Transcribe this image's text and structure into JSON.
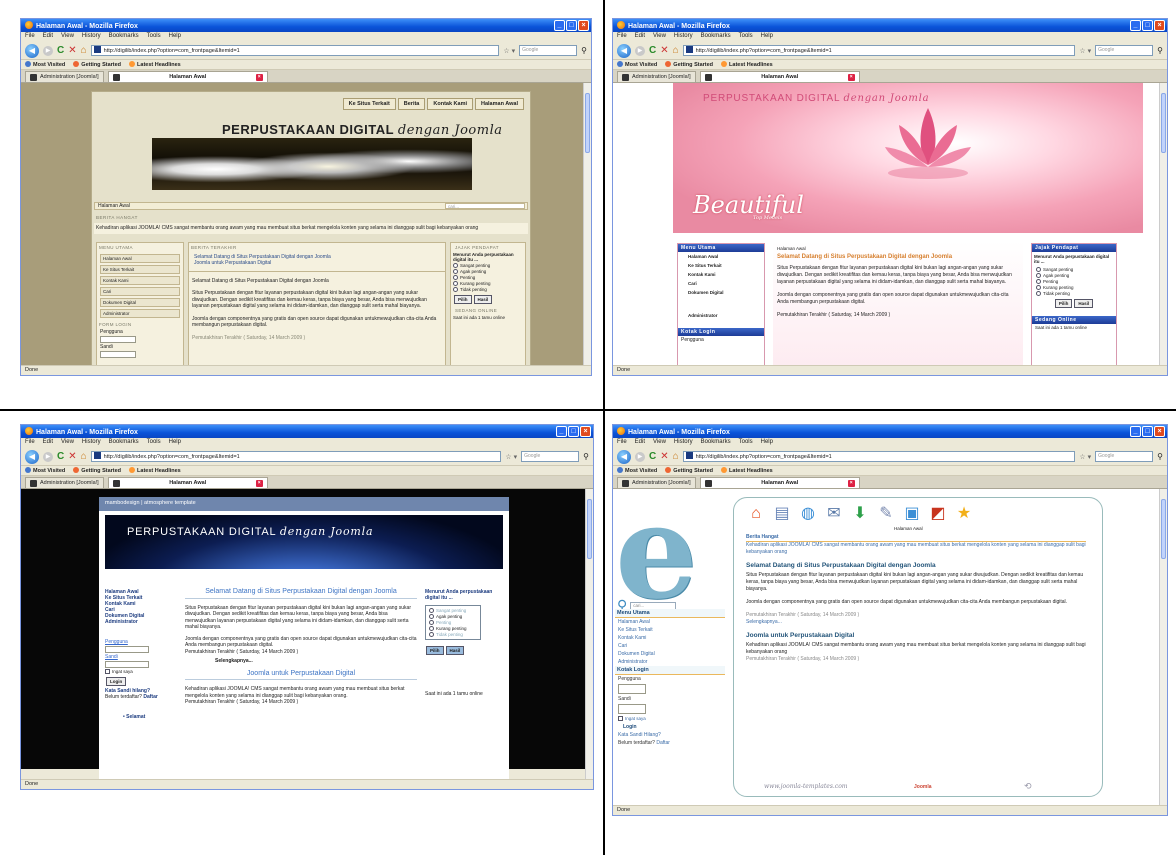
{
  "browser": {
    "window_title": "Halaman Awal - Mozilla Firefox",
    "menu": [
      "File",
      "Edit",
      "View",
      "History",
      "Bookmarks",
      "Tools",
      "Help"
    ],
    "url": "http://digilib/index.php?option=com_frontpage&Itemid=1",
    "search_placeholder": "Google",
    "bookmarks": [
      "Most Visited",
      "Getting Started",
      "Latest Headlines"
    ],
    "tab_inactive": "Administration [Joomla!]",
    "tab_active": "Halaman Awal",
    "status": "Done"
  },
  "site1": {
    "menu": [
      "Ke Situs Terkait",
      "Berita",
      "Kontak Kami",
      "Halaman Awal"
    ],
    "title_main": "PERPUSTAKAAN DIGITAL",
    "title_script": "dengan Joomla",
    "breadcrumb": "Halaman Awal",
    "search": "cari...",
    "heading_berita": "BERITA HANGAT",
    "intro": "Kehadiran aplikasi JOOMLA! CMS sangat membantu orang awam yang mau membuat situs berkat mengelola konten yang selama ini dianggap sulit bagi kebanyakan orang",
    "menu_utama_title": "MENU UTAMA",
    "menu_utama": [
      "Halaman Awal",
      "Ke Situs Terkait",
      "Kontak Kami",
      "Cari",
      "Dokumen Digital",
      "Administrator"
    ],
    "login_title": "FORM LOGIN",
    "login_user": "Pengguna",
    "login_pass": "Sandi",
    "berita_terakhir_title": "BERITA TERAKHIR",
    "berita_terakhir": [
      "Selamat Datang di Situs Perpustakaan Digital dengan Joomla",
      "Joomla untuk Perpustakaan Digital"
    ],
    "article_title": "Selamat Datang di Situs Perpustakaan Digital dengan Joomla",
    "article_body": "Situs Perpustakaan dengan fitur layanan perpustakaan digital kini bukan lagi angan-angan yang sukar diwujudkan. Dengan sedikit kreatifitas dan kemau keras, tanpa biaya yang besar, Anda bisa menwujudkan layanan perpustakaan digital yang selama ini didam-idamkan, dan dianggap sulit serta mahal biayanya.",
    "article_body2": "Joomla dengan componentnya yang gratis dan open source dapat digunakan untukmewujudkan cita-cita Anda membangun perpustakaan digital.",
    "article_updated": "Pemutakhiran Terakhir ( Saturday, 14 March 2009 )",
    "poll_title": "JAJAK PENDAPAT",
    "poll_question": "Menurut Anda perpustakaan digital itu ...",
    "poll_options": [
      "Sangat penting",
      "Agak penting",
      "Penting",
      "Kurang penting",
      "Tidak penting"
    ],
    "poll_vote": "Pilih",
    "poll_result": "Hasil",
    "online_title": "SEDANG ONLINE",
    "online_text": "Saat ini ada 1 tamu online"
  },
  "site2": {
    "title_main": "PERPUSTAKAAN DIGITAL",
    "title_script": "dengan Joomla",
    "beautiful": "Beautiful",
    "beautiful_sub": "Top Models",
    "menu_utama_title": "Menu Utama",
    "menu_utama": [
      "Halaman Awal",
      "Ke Situs Terkait",
      "Kontak Kami",
      "Cari",
      "Dokumen Digital",
      "Administrator"
    ],
    "login_title": "Kotak Login",
    "login_user": "Pengguna",
    "breadcrumb": "Halaman Awal",
    "article_title": "Selamat Datang di Situs Perpustakaan Digital dengan Joomla",
    "article_body": "Situs Perpustakaan dengan fitur layanan perpustakaan digital kini bukan lagi angan-angan yang sukar diwujudkan. Dengan sedikit kreatifitas dan kemau keras, tanpa biaya yang besar, Anda bisa menwujudkan layanan perpustakaan digital yang selama ini didam-idamkan, dan dianggap sulit serta mahal biayanya.",
    "article_body2": "Joomla dengan componentnya yang gratis dan open source dapat digunakan untukmewujudkan cita-cita Anda membangun perpustakaan digital.",
    "article_updated": "Pemutakhiran Terakhir ( Saturday, 14 March 2009 )",
    "poll_title": "Jajak Pendapat",
    "poll_question": "Menurut Anda perpustakaan digital itu ...",
    "poll_options": [
      "Sangat penting",
      "Agak penting",
      "Penting",
      "Kurang penting",
      "Tidak penting"
    ],
    "poll_vote": "Pilih",
    "poll_result": "Hasil",
    "online_title": "Sedang Online",
    "online_text": "Saat ini ada 1 tamu online"
  },
  "site3": {
    "top": "mambodesign | atmosphere template",
    "title_main": "PERPUSTAKAAN DIGITAL",
    "title_script": "dengan Joomla",
    "menu": [
      "Halaman Awal",
      "Ke Situs Terkait",
      "Kontak Kami",
      "Cari",
      "Dokumen Digital",
      "Administrator"
    ],
    "login_user": "Pengguna",
    "login_pass": "Sandi",
    "remember": "Ingat saya",
    "login_btn": "Login",
    "forgot": "Kata Sandi hilang?",
    "register_q": "Belum terdaftar?",
    "register": "Daftar",
    "bullet": "Selamat",
    "article_title": "Selamat Datang di Situs Perpustakaan Digital dengan Joomla",
    "article_body": "Situs Perpustakaan dengan fitur layanan perpustakaan digital kini bukan lagi angan-angan yang sukar diwujudkan. Dengan sedikit kreatifitas dan kemau keras, tanpa biaya yang besar, Anda bisa menwujudkan layanan perpustakaan digital yang selama ini didam-idamkan, dan dianggap sulit serta mahal biayanya.",
    "article_body2": "Joomla dengan componentnya yang gratis dan open source dapat digunakan untukmewujudkan cita-cita Anda membangun perpustakaan digital.",
    "article_updated": "Pemutakhiran Terakhir ( Saturday, 14 March 2009 )",
    "readmore": "Selengkapnya...",
    "article2_title": "Joomla untuk Perpustakaan Digital",
    "article2_body": "Kehadiran aplikasi JOOMLA! CMS sangat membantu orang awam yang mau membuat situs berkat mengelola konten yang selama ini dianggap sulit bagi kebanyakan orang.",
    "article2_updated": "Pemutakhiran Terakhir ( Saturday, 14 March 2009 )",
    "poll_question": "Menurut Anda perpustakaan digital itu ...",
    "poll_options": [
      "Sangat penting",
      "Agak penting",
      "Penting",
      "Kurang penting",
      "Tidak penting"
    ],
    "poll_vote": "Pilih",
    "poll_result": "Hasil",
    "online_text": "Saat ini ada 1 tamu online"
  },
  "site4": {
    "icon_caption": "Halaman Awal",
    "berita_title": "Berita Hangat",
    "intro": "Kehadiran aplikasi JOOMLA! CMS sangat membantu orang awam yang mau membuat situs berkat mengelola konten yang selama ini dianggap sulit bagi kebanyakan orang",
    "search": "cari...",
    "menu_utama_title": "Menu Utama",
    "menu_utama": [
      "Halaman Awal",
      "Ke Situs Terkait",
      "Kontak Kami",
      "Cari",
      "Dokumen Digital",
      "Administrator"
    ],
    "login_title": "Kotak Login",
    "login_user": "Pengguna",
    "login_pass": "Sandi",
    "remember": "Ingat saya",
    "login_btn": "Login",
    "forgot": "Kata Sandi Hilang?",
    "register_q": "Belum terdaftar?",
    "register": "Daftar",
    "article_title": "Selamat Datang di Situs Perpustakaan Digital dengan Joomla",
    "article_body": "Situs Perpustakaan dengan fitur layanan perpustakaan digital kini bukan lagi angan-angan yang sukar diwujudkan. Dengan sedikit kreatifitas dan kemau keras, tanpa biaya yang besar, Anda bisa menwujudkan layanan perpustakaan digital yang selama ini didam-idamkan, dan dianggap sulit serta mahal biayanya.",
    "article_body2": "Joomla dengan componentnya yang gratis dan open source dapat digunakan untukmewujudkan cita-cita Anda membangun perpustakaan digital.",
    "article_updated": "Pemutakhiran Terakhir ( Saturday, 14 March 2009 )",
    "readmore": "Selengkapnya...",
    "article2_title": "Joomla untuk Perpustakaan Digital",
    "article2_body": "Kehadiran aplikasi JOOMLA! CMS sangat membantu orang awam yang mau membuat situs berkat mengelola konten yang selama ini dianggap sulit bagi kebanyakan orang",
    "article2_updated": "Pemutakhiran Terakhir ( Saturday, 14 March 2009 )",
    "footer_left": "www.joomla-templates.com",
    "footer_mid": "Joomla"
  }
}
